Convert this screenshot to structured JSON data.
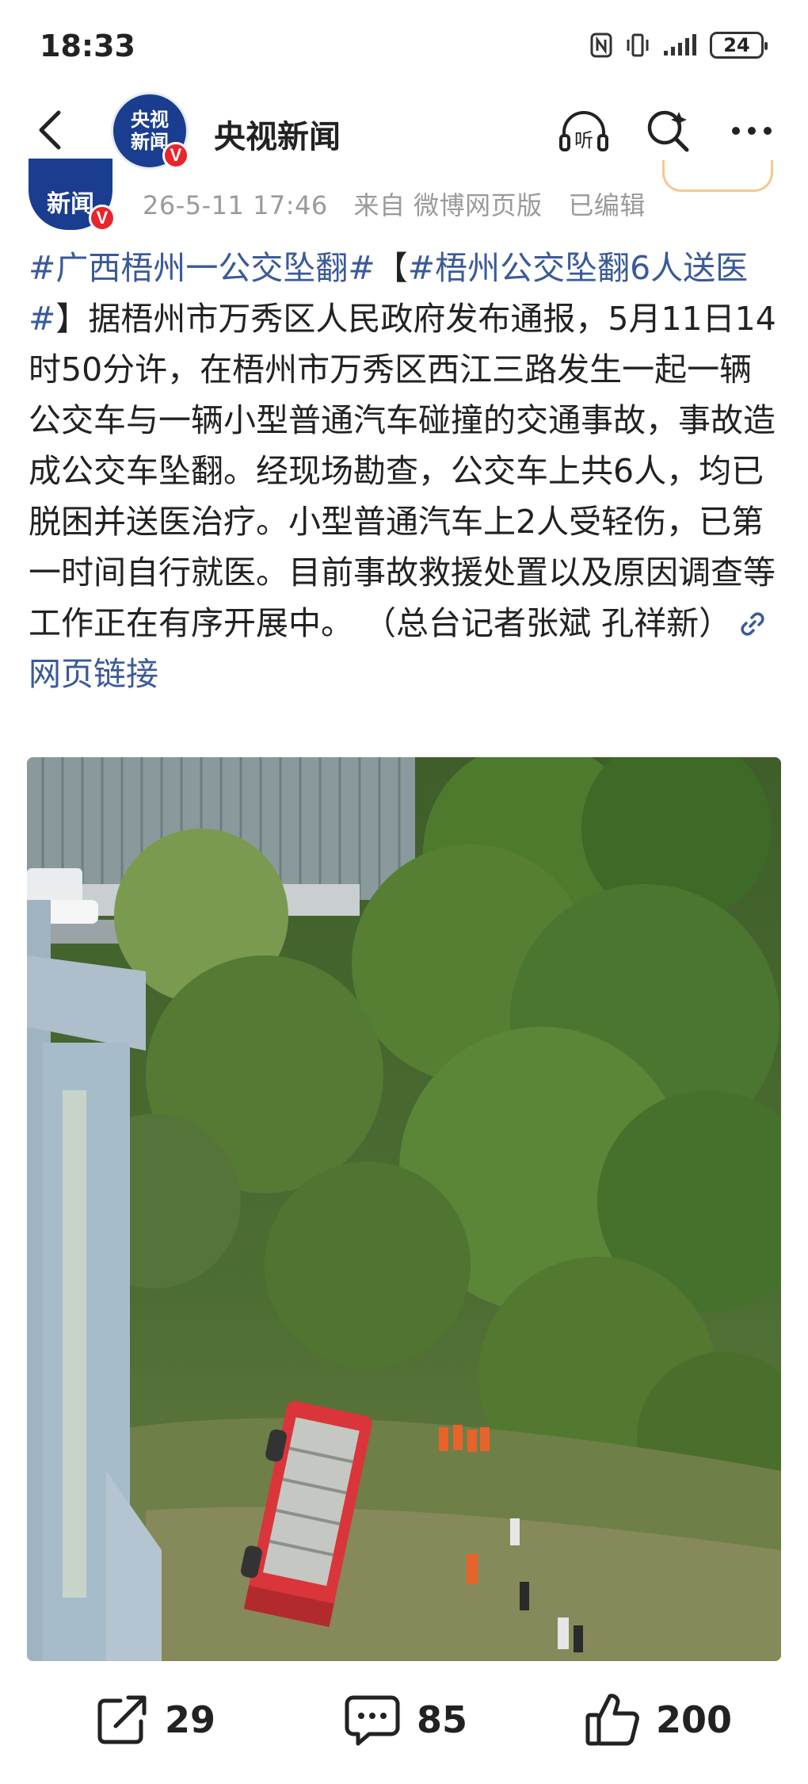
{
  "status_bar": {
    "time": "18:33",
    "battery": "24",
    "icons": [
      "nfc-icon",
      "vibrate-icon",
      "signal-icon",
      "battery-icon"
    ]
  },
  "header": {
    "account_name": "央视新闻",
    "avatar_text_line1": "央视",
    "avatar_text_line2": "新闻",
    "verified_badge": "V",
    "actions": [
      "listen-icon",
      "search-icon",
      "more-icon"
    ],
    "listen_label": "听"
  },
  "post": {
    "avatar_text": "新闻",
    "date": "26-5-11 17:46",
    "source": "来自 微博网页版",
    "edited": "已编辑",
    "hashtag1": "#广西梧州一公交坠翻#",
    "hashtag2_open": "【",
    "hashtag2": "#梧州公交坠翻6人送医#",
    "hashtag2_close": "】",
    "body": "据梧州市万秀区人民政府发布通报，5月11日14时50分许，在梧州市万秀区西江三路发生一起一辆公交车与一辆小型普通汽车碰撞的交通事故，事故造成公交车坠翻。经现场勘查，公交车上共6人，均已脱困并送医治疗。小型普通汽车上2人受轻伤，已第一时间自行就医。目前事故救援处置以及原因调查等工作正在有序开展中。 （总台记者张斌 孔祥新）",
    "link_text": "网页链接"
  },
  "actions_bar": {
    "repost_count": "29",
    "comment_count": "85",
    "like_count": "200"
  },
  "colors": {
    "link": "#3a5a99",
    "avatar_bg": "#1a3d8f",
    "verified": "#e8252a",
    "bus": "#d9353a"
  }
}
